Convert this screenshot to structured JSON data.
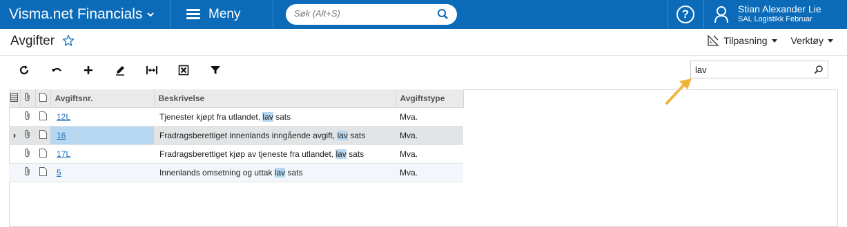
{
  "app": {
    "title": "Visma.net Financials",
    "menu_label": "Meny",
    "search_placeholder": "Søk (Alt+S)"
  },
  "user": {
    "name": "Stian Alexander Lie",
    "company": "SAL Logistikk Februar"
  },
  "page": {
    "title": "Avgifter",
    "customize_label": "Tilpasning",
    "tools_label": "Verktøy"
  },
  "toolbar": {
    "buttons": [
      "refresh-icon",
      "undo-icon",
      "add-icon",
      "edit-icon",
      "fit-columns-icon",
      "delete-icon",
      "filter-icon"
    ]
  },
  "grid": {
    "search_value": "lav",
    "columns": [
      "Avgiftsnr.",
      "Beskrivelse",
      "Avgiftstype"
    ],
    "rows": [
      {
        "code": "12L",
        "desc_pre": "Tjenester kjøpt fra utlandet, ",
        "desc_hl": "lav",
        "desc_post": " sats",
        "type": "Mva.",
        "pointer": ""
      },
      {
        "code": "16",
        "desc_pre": "Fradragsberettiget innenlands inngående avgift, ",
        "desc_hl": "lav",
        "desc_post": " sats",
        "type": "Mva.",
        "pointer": "›"
      },
      {
        "code": "17L",
        "desc_pre": "Fradragsberettiget kjøp av tjeneste fra utlandet, ",
        "desc_hl": "lav",
        "desc_post": " sats",
        "type": "Mva.",
        "pointer": ""
      },
      {
        "code": "5",
        "desc_pre": "Innenlands omsetning og uttak ",
        "desc_hl": "lav",
        "desc_post": " sats",
        "type": "Mva.",
        "pointer": ""
      }
    ]
  },
  "colors": {
    "topbar": "#0b6bb8",
    "highlight": "#b7d7f0",
    "link": "#1b6fb8",
    "arrow": "#f0b43a"
  }
}
